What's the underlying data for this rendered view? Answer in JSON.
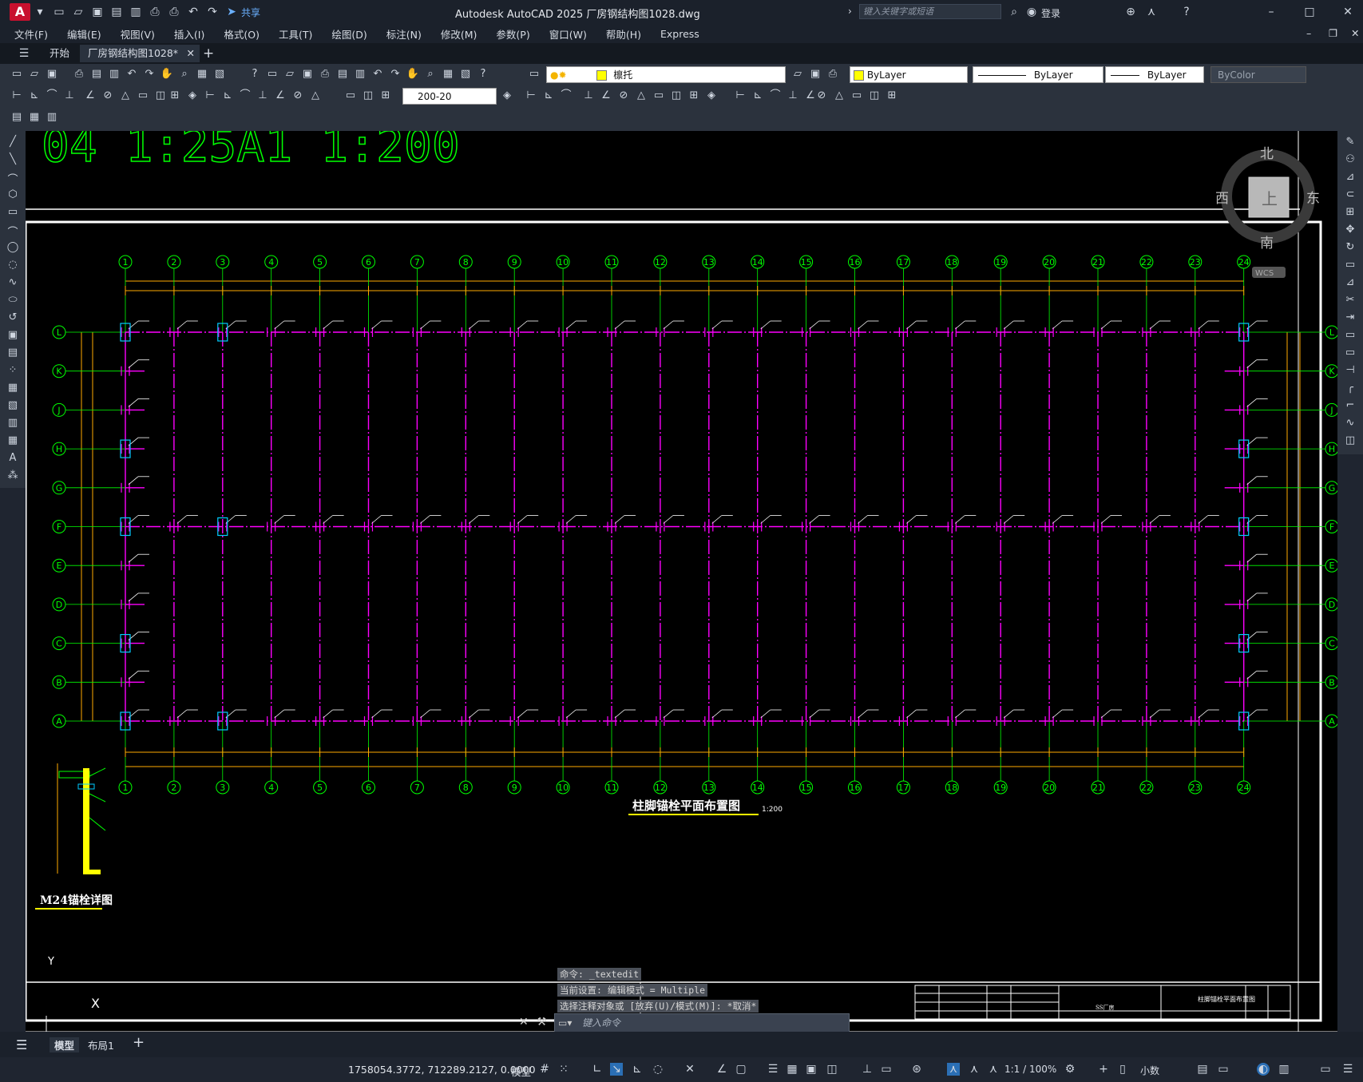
{
  "app": {
    "logo": "A",
    "title": "Autodesk AutoCAD 2025    厂房钢结构图1028.dwg",
    "share_label": "共享",
    "search_placeholder": "键入关键字或短语",
    "signin_label": "登录"
  },
  "menu": [
    "文件(F)",
    "编辑(E)",
    "视图(V)",
    "插入(I)",
    "格式(O)",
    "工具(T)",
    "绘图(D)",
    "标注(N)",
    "修改(M)",
    "参数(P)",
    "窗口(W)",
    "帮助(H)",
    "Express"
  ],
  "tabs": {
    "start": "开始",
    "doc": "厂房钢结构图1028*"
  },
  "toolbars": {
    "layer_name": "檩托",
    "color": "ByLayer",
    "linetype": "ByLayer",
    "lineweight": "ByLayer",
    "plotstyle": "ByColor",
    "dimstyle": "200-20"
  },
  "viewcube": {
    "north": "北",
    "south": "南",
    "east": "东",
    "west": "西",
    "face": "上",
    "ucs": "WCS"
  },
  "drawing": {
    "header_text": "04   1:25A1  1:200",
    "plan_title": "柱脚锚栓平面布置图",
    "plan_scale": "1:200",
    "detail_title": "M24锚栓详图",
    "axes_numbers": [
      "1",
      "2",
      "3",
      "4",
      "5",
      "6",
      "7",
      "8",
      "9",
      "10",
      "11",
      "12",
      "13",
      "14",
      "15",
      "16",
      "17",
      "18",
      "19",
      "20",
      "21",
      "22",
      "23",
      "24"
    ],
    "axes_letters": [
      "L",
      "K",
      "J",
      "H",
      "G",
      "F",
      "E",
      "D",
      "C",
      "B",
      "A"
    ],
    "titleblock_name": "柱脚锚栓平面布置图",
    "titleblock_project": "SS厂房"
  },
  "command": {
    "history": [
      "命令: _textedit",
      "当前设置: 编辑模式 = Multiple",
      "选择注释对象或 [放弃(U)/模式(M)]: *取消*"
    ],
    "placeholder": "键入命令"
  },
  "layouts": {
    "model": "模型",
    "layout1": "布局1"
  },
  "status": {
    "coords": "1758054.3772, 712289.2127, 0.0000",
    "model_label": "模型",
    "scale": "1:1 / 100%",
    "units": "小数"
  },
  "colors": {
    "grid_axis": "#00ff00",
    "columns": "#ff00ff",
    "dims": "#ffaa00",
    "frame": "#ffffff",
    "base": "#00ccff"
  }
}
